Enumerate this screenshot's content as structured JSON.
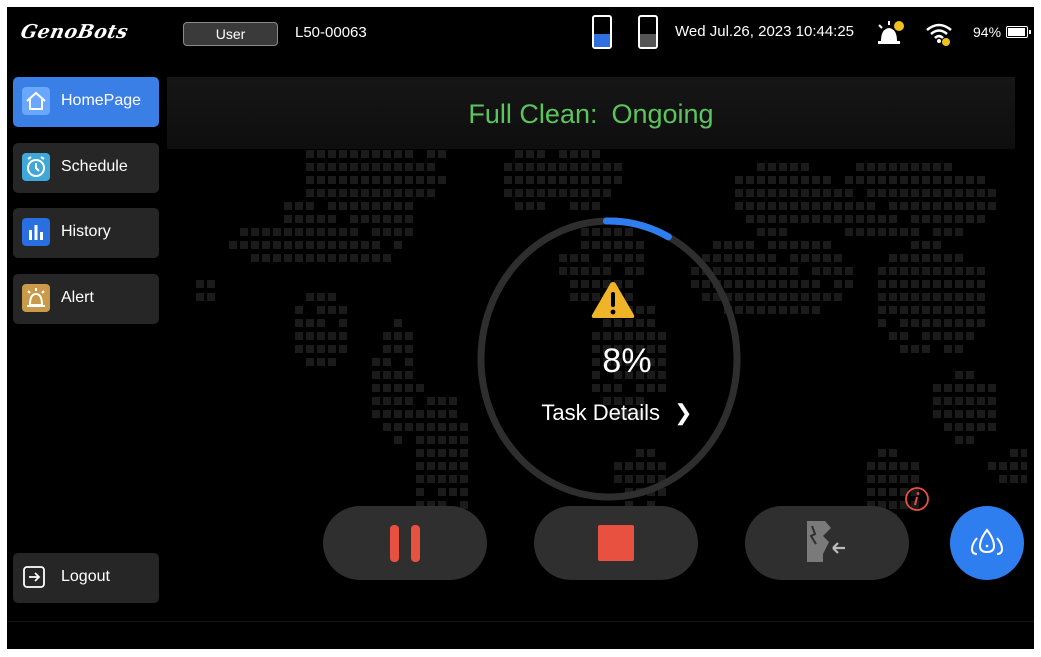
{
  "topbar": {
    "logo_text": "GenoBots",
    "user_label": "User",
    "device_id": "L50-00063",
    "datetime": "Wed Jul.26, 2023 10:44:25",
    "battery_percent": "94%",
    "battery_level": 0.94,
    "tank_clean_level": 0.45,
    "tank_dirty_level": 0.45,
    "alarm_icon": "alarm-bell-icon",
    "wifi_icon": "wifi-icon"
  },
  "sidebar": {
    "items": [
      {
        "label": "HomePage",
        "icon": "home-icon",
        "icon_color": "#6aa8ff",
        "active": true
      },
      {
        "label": "Schedule",
        "icon": "clock-icon",
        "icon_color": "#3fa8d8",
        "active": false
      },
      {
        "label": "History",
        "icon": "bar-chart-icon",
        "icon_color": "#2a6fe0",
        "active": false
      },
      {
        "label": "Alert",
        "icon": "alarm-icon",
        "icon_color": "#c89a4a",
        "active": false
      }
    ],
    "logout_label": "Logout"
  },
  "status": {
    "mode": "Full Clean:",
    "state": "Ongoing",
    "color": "#5cc45c"
  },
  "progress": {
    "percent_label": "8%",
    "value": 0.08,
    "task_details_label": "Task Details",
    "accent": "#2f7ef0"
  },
  "controls": {
    "pause_icon": "pause-icon",
    "stop_icon": "stop-icon",
    "dock_icon": "return-to-dock-icon",
    "water_icon": "water-drops-icon",
    "info_icon": "info-icon",
    "red": "#e8503f"
  }
}
